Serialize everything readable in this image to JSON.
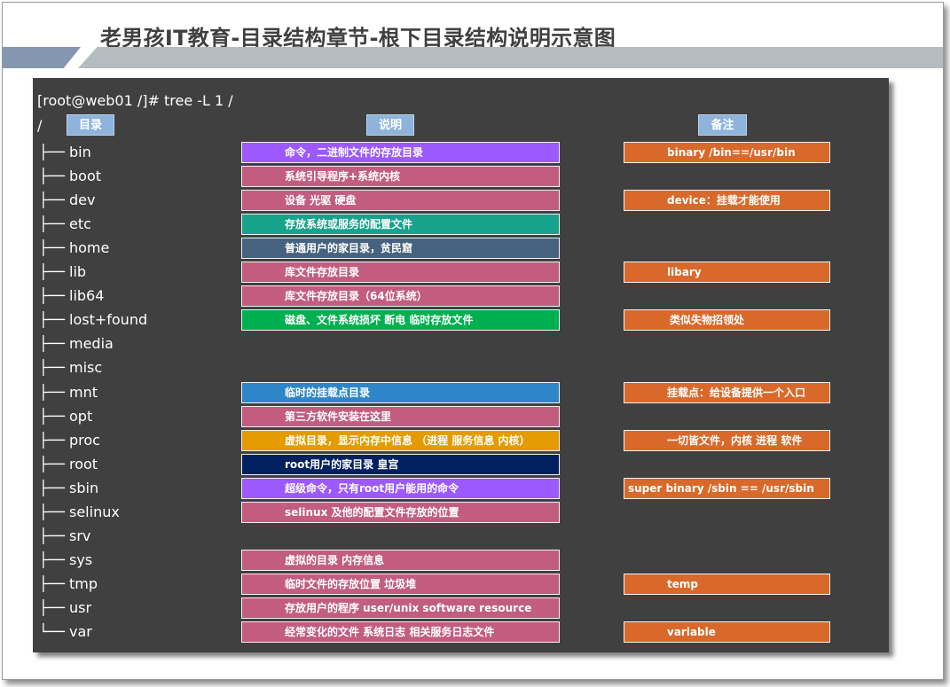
{
  "title": "老男孩IT教育-目录结构章节-根下目录结构说明示意图",
  "command": "[root@web01 /]# tree -L 1 /",
  "root_slash": "/",
  "headers": {
    "dir": "目录",
    "desc": "说明",
    "note": "备注"
  },
  "colors": {
    "panel": "#404040",
    "header": "#8fb4dc",
    "band_blue": "#8596b0",
    "band_gray": "#b5bcc0",
    "purple": "#9b59ff",
    "rose": "#c25d80",
    "teal": "#16a38b",
    "slate": "#46627e",
    "green": "#00b050",
    "blue": "#2e86c8",
    "amber": "#e39b00",
    "navy": "#002060",
    "orange": "#d9692a"
  },
  "tree_branch": "├──",
  "tree_last_branch": "└──",
  "rows": [
    {
      "dir": "bin",
      "desc": "命令，二进制文件的存放目录",
      "desc_color": "purple",
      "note": "binary /bin==/usr/bin",
      "note_indent": 48
    },
    {
      "dir": "boot",
      "desc": "系统引导程序+系统内核",
      "desc_color": "rose"
    },
    {
      "dir": "dev",
      "desc": "设备 光驱 硬盘",
      "desc_color": "rose",
      "note": "device：挂载才能使用",
      "note_indent": 48
    },
    {
      "dir": "etc",
      "desc": "存放系统或服务的配置文件",
      "desc_color": "teal"
    },
    {
      "dir": "home",
      "desc": "普通用户的家目录，贫民窟",
      "desc_color": "slate"
    },
    {
      "dir": "lib",
      "desc": "库文件存放目录",
      "desc_color": "rose",
      "note": "libary",
      "note_indent": 48
    },
    {
      "dir": "lib64",
      "desc": "库文件存放目录（64位系统）",
      "desc_color": "rose"
    },
    {
      "dir": "lost+found",
      "desc": "磁盘、文件系统损坏 断电 临时存放文件",
      "desc_color": "green",
      "note": "类似失物招领处",
      "note_indent": 51
    },
    {
      "dir": "media"
    },
    {
      "dir": "misc"
    },
    {
      "dir": "mnt",
      "desc": "临时的挂载点目录",
      "desc_color": "blue",
      "note": "挂载点：给设备提供一个入口",
      "note_indent": 48
    },
    {
      "dir": "opt",
      "desc": "第三方软件安装在这里",
      "desc_color": "rose"
    },
    {
      "dir": "proc",
      "desc": "虚拟目录，显示内存中信息 （进程 服务信息 内核）",
      "desc_color": "amber",
      "note": "一切皆文件，内核 进程 软件",
      "note_indent": 48
    },
    {
      "dir": "root",
      "desc": "root用户的家目录 皇宫",
      "desc_color": "navy"
    },
    {
      "dir": "sbin",
      "desc": "超级命令，只有root用户能用的命令",
      "desc_color": "purple",
      "note": "super binary /sbin == /usr/sbin",
      "note_indent": 4
    },
    {
      "dir": "selinux",
      "desc": "selinux 及他的配置文件存放的位置",
      "desc_color": "rose"
    },
    {
      "dir": "srv"
    },
    {
      "dir": "sys",
      "desc": "虚拟的目录 内存信息",
      "desc_color": "rose"
    },
    {
      "dir": "tmp",
      "desc": "临时文件的存放位置 垃圾堆",
      "desc_color": "rose",
      "note": "temp",
      "note_indent": 48
    },
    {
      "dir": "usr",
      "desc": "存放用户的程序 user/unix software resource",
      "desc_color": "rose"
    },
    {
      "dir": "var",
      "desc": "经常变化的文件 系统日志 相关服务日志文件",
      "desc_color": "rose",
      "note": "variable",
      "note_indent": 48
    }
  ]
}
